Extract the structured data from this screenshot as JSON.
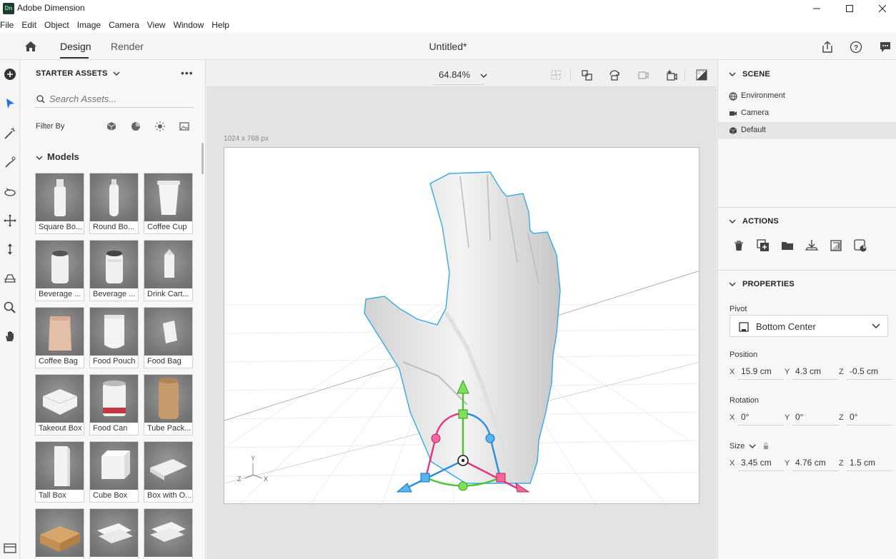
{
  "titlebar": {
    "logo_text": "Dn",
    "app_name": "Adobe Dimension",
    "controls": [
      "minimize-icon",
      "maximize-icon",
      "close-icon"
    ]
  },
  "menu": [
    "File",
    "Edit",
    "Object",
    "Image",
    "Camera",
    "View",
    "Window",
    "Help"
  ],
  "header": {
    "tabs": [
      "Design",
      "Render"
    ],
    "active_tab": "Design",
    "document_title": "Untitled*",
    "right_icons": [
      "share-icon",
      "help-icon",
      "feedback-icon"
    ]
  },
  "toolbar": {
    "tools": [
      "add-icon",
      "select-icon",
      "magic-wand-icon",
      "sample-icon",
      "orbit-icon",
      "move-icon",
      "vertical-move-icon",
      "perspective-icon",
      "zoom-icon",
      "pan-icon"
    ],
    "active_tool": "select-icon"
  },
  "assets": {
    "title": "STARTER ASSETS",
    "more": "•••",
    "search_placeholder": "Search Assets...",
    "filter_label": "Filter By",
    "filter_icons": [
      "models-filter-icon",
      "materials-filter-icon",
      "lights-filter-icon",
      "images-filter-icon"
    ],
    "section": "Models",
    "tiles": [
      {
        "label": "Square Bo...",
        "shape": "bottle-square"
      },
      {
        "label": "Round Bo...",
        "shape": "bottle-round"
      },
      {
        "label": "Coffee Cup",
        "shape": "cup"
      },
      {
        "label": "Beverage ...",
        "shape": "can"
      },
      {
        "label": "Beverage ...",
        "shape": "can2"
      },
      {
        "label": "Drink Cart...",
        "shape": "carton"
      },
      {
        "label": "Coffee Bag",
        "shape": "bag"
      },
      {
        "label": "Food Pouch",
        "shape": "pouch"
      },
      {
        "label": "Food Bag",
        "shape": "foodbag"
      },
      {
        "label": "Takeout Box",
        "shape": "takeout"
      },
      {
        "label": "Food Can",
        "shape": "foodcan"
      },
      {
        "label": "Tube Pack...",
        "shape": "tube"
      },
      {
        "label": "Tall Box",
        "shape": "tallbox"
      },
      {
        "label": "Cube Box",
        "shape": "cube"
      },
      {
        "label": "Box with O...",
        "shape": "boxopen"
      },
      {
        "label": "",
        "shape": "parcel"
      },
      {
        "label": "",
        "shape": "cards"
      },
      {
        "label": "",
        "shape": "cards2"
      }
    ]
  },
  "viewport": {
    "zoom": "64.84%",
    "canvas_size": "1024 x 768 px",
    "axis_labels": {
      "x": "X",
      "y": "Y",
      "z": "Z"
    },
    "icons": [
      "fit-icon",
      "frame-selection-icon",
      "rotate-camera-icon",
      "camera-bookmark-icon",
      "sparkle-camera-icon",
      "render-preview-icon"
    ]
  },
  "scene": {
    "title": "SCENE",
    "items": [
      {
        "label": "Environment",
        "icon": "globe-icon",
        "selected": false
      },
      {
        "label": "Camera",
        "icon": "camera-icon",
        "selected": false
      },
      {
        "label": "Default",
        "icon": "cube-icon",
        "selected": true
      }
    ]
  },
  "actions": {
    "title": "ACTIONS",
    "icons": [
      "delete-icon",
      "duplicate-icon",
      "group-icon",
      "drop-to-ground-icon",
      "align-icon",
      "material-icon"
    ]
  },
  "properties": {
    "title": "PROPERTIES",
    "pivot_label": "Pivot",
    "pivot_value": "Bottom Center",
    "position_label": "Position",
    "position": {
      "x": "15.9 cm",
      "y": "4.3 cm",
      "z": "-0.5 cm"
    },
    "rotation_label": "Rotation",
    "rotation": {
      "x": "0°",
      "y": "0°",
      "z": "0°"
    },
    "size_label": "Size",
    "size": {
      "x": "3.45 cm",
      "y": "4.76 cm",
      "z": "1.5 cm"
    },
    "axis": {
      "x": "X",
      "y": "Y",
      "z": "Z"
    }
  }
}
